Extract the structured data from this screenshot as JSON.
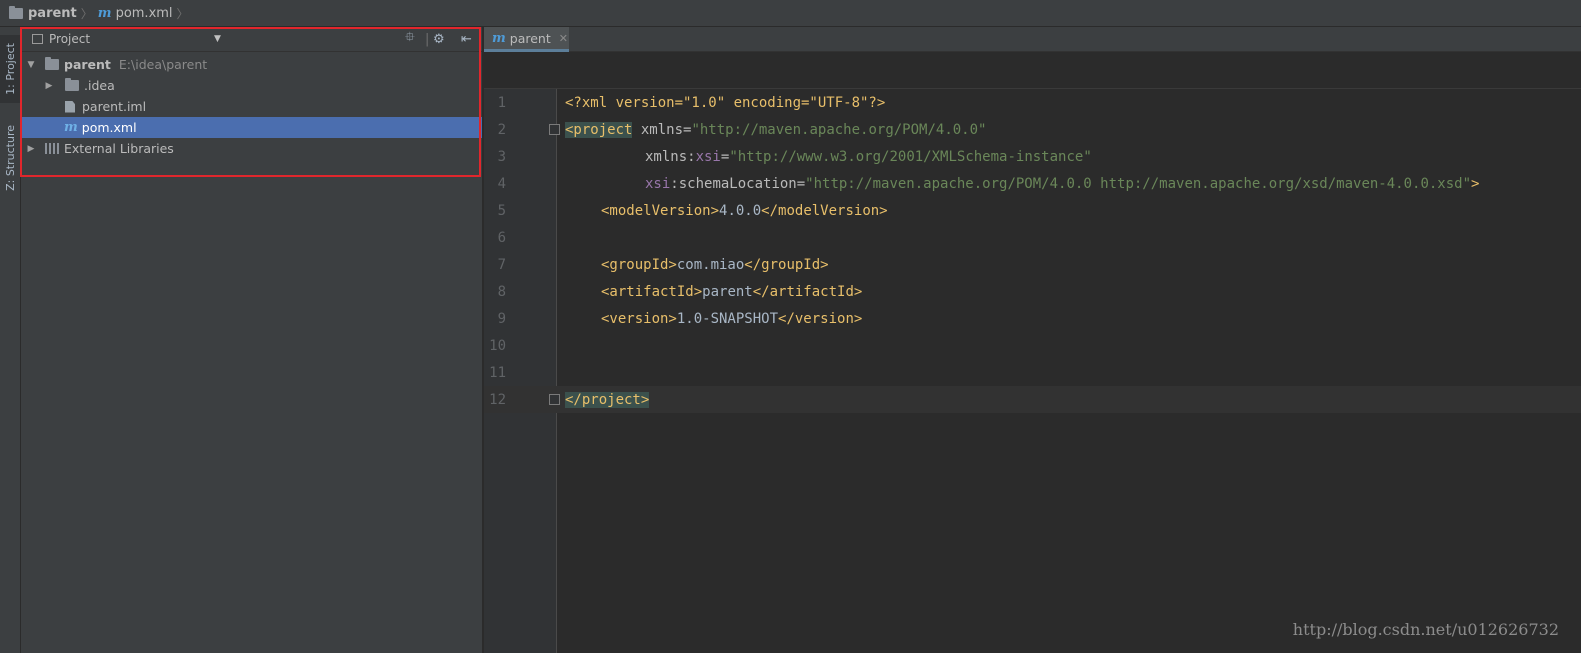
{
  "navbar": {
    "project_name": "parent",
    "file_name": "pom.xml",
    "file_icon": "m"
  },
  "toolstrip": {
    "project_tab": "1: Project",
    "structure_tab": "Z: Structure"
  },
  "project_panel": {
    "title": "Project",
    "tree": {
      "root_name": "parent",
      "root_path": "E:\\idea\\parent",
      "idea_folder": ".idea",
      "iml_file": "parent.iml",
      "pom_file": "pom.xml",
      "external_libraries": "External Libraries"
    }
  },
  "editor": {
    "tab_label": "parent",
    "tab_icon": "m",
    "lines": [
      {
        "n": "1"
      },
      {
        "n": "2"
      },
      {
        "n": "3"
      },
      {
        "n": "4"
      },
      {
        "n": "5"
      },
      {
        "n": "6"
      },
      {
        "n": "7"
      },
      {
        "n": "8"
      },
      {
        "n": "9"
      },
      {
        "n": "10"
      },
      {
        "n": "11"
      },
      {
        "n": "12"
      }
    ],
    "code": {
      "l1_pi": "<?xml version=\"1.0\" encoding=\"UTF-8\"?>",
      "l2_tag": "<project",
      "l2_attr": " xmlns=",
      "l2_val": "\"http://maven.apache.org/POM/4.0.0\"",
      "l3_attr": "xmlns:",
      "l3_ns": "xsi",
      "l3_eq": "=",
      "l3_val": "\"http://www.w3.org/2001/XMLSchema-instance\"",
      "l4_ns": "xsi",
      "l4_attr": ":schemaLocation=",
      "l4_val": "\"http://maven.apache.org/POM/4.0.0 http://maven.apache.org/xsd/maven-4.0.0.xsd\"",
      "l4_close": ">",
      "l5_open": "<modelVersion>",
      "l5_text": "4.0.0",
      "l5_close": "</modelVersion>",
      "l7_open": "<groupId>",
      "l7_text": "com.miao",
      "l7_close": "</groupId>",
      "l8_open": "<artifactId>",
      "l8_text": "parent",
      "l8_close": "</artifactId>",
      "l9_open": "<version>",
      "l9_text": "1.0-SNAPSHOT",
      "l9_close": "</version>",
      "l12_tag": "</project>"
    }
  },
  "watermark": "http://blog.csdn.net/u012626732",
  "colors": {
    "selection": "#4b6eaf",
    "highlight_box": "#e1262c",
    "xml_tag": "#e8bf6a",
    "xml_value": "#6a8759",
    "namespace": "#9876aa"
  }
}
